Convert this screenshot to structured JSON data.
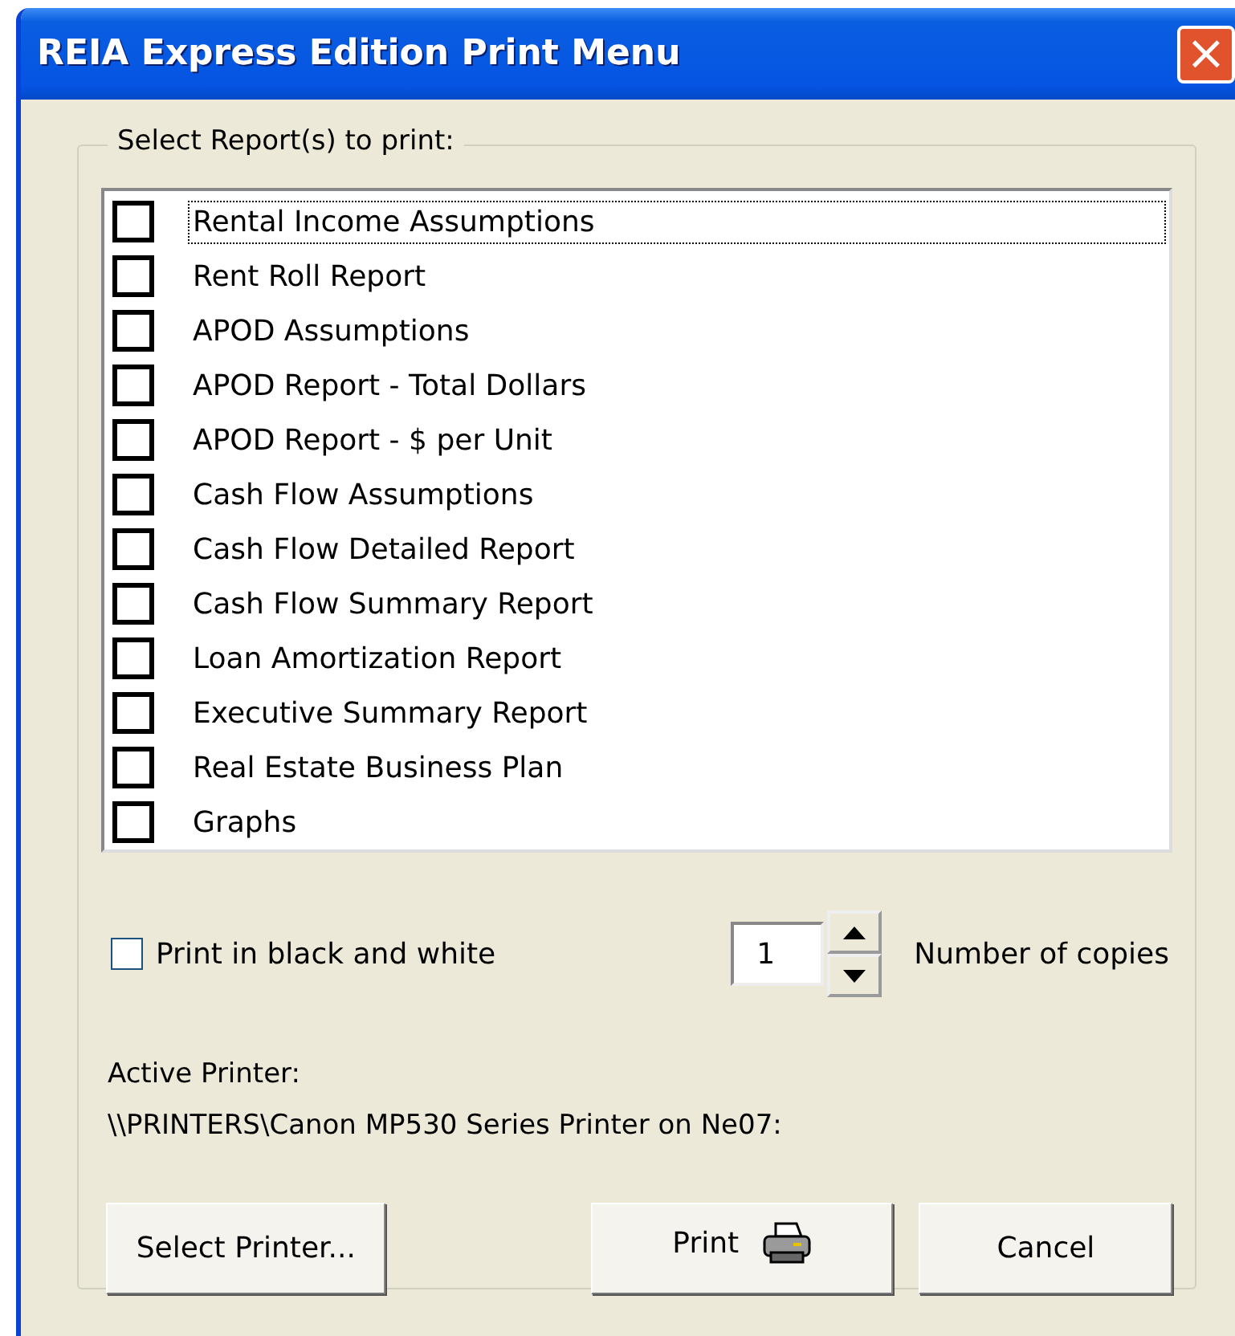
{
  "window": {
    "title": "REIA Express Edition Print Menu",
    "close_button": "×"
  },
  "group": {
    "label": "Select Report(s) to print:"
  },
  "reports": [
    {
      "label": "Rental Income Assumptions",
      "checked": false,
      "focused": true
    },
    {
      "label": "Rent Roll Report",
      "checked": false,
      "focused": false
    },
    {
      "label": "APOD Assumptions",
      "checked": false,
      "focused": false
    },
    {
      "label": "APOD Report - Total Dollars",
      "checked": false,
      "focused": false
    },
    {
      "label": "APOD Report - $ per Unit",
      "checked": false,
      "focused": false
    },
    {
      "label": "Cash Flow Assumptions",
      "checked": false,
      "focused": false
    },
    {
      "label": "Cash Flow Detailed Report",
      "checked": false,
      "focused": false
    },
    {
      "label": "Cash Flow Summary Report",
      "checked": false,
      "focused": false
    },
    {
      "label": "Loan Amortization Report",
      "checked": false,
      "focused": false
    },
    {
      "label": "Executive Summary Report",
      "checked": false,
      "focused": false
    },
    {
      "label": "Real Estate Business Plan",
      "checked": false,
      "focused": false
    },
    {
      "label": "Graphs",
      "checked": false,
      "focused": false
    }
  ],
  "black_and_white": {
    "label": "Print in black and white",
    "checked": false
  },
  "copies": {
    "value": "1",
    "label": "Number of copies"
  },
  "active_printer": {
    "label": "Active Printer:",
    "value": "\\\\PRINTERS\\Canon MP530 Series Printer on Ne07:"
  },
  "buttons": [
    {
      "kind": "select",
      "label": "Select Printer..."
    },
    {
      "kind": "print",
      "label": "Print"
    },
    {
      "kind": "cancel",
      "label": "Cancel"
    }
  ]
}
